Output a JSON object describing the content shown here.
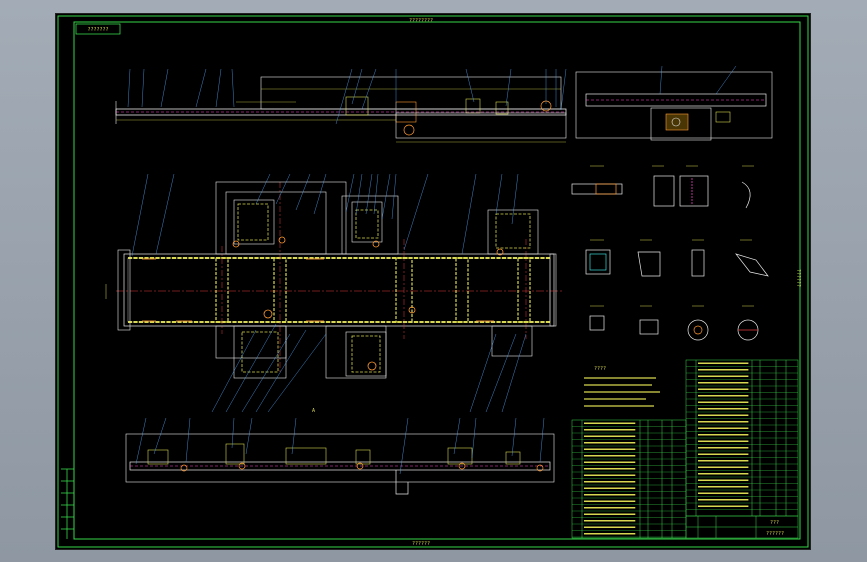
{
  "drawing": {
    "top_title": "????????",
    "corner_label": "???????",
    "side_label": "??????",
    "bottom_label": "??????",
    "view_label": "A"
  },
  "tables": {
    "notes_title": "????",
    "title_block_name": "???",
    "title_block_code": "??????"
  },
  "colors": {
    "sheet_bg": "#000000",
    "frame": "#39d64a",
    "outline": "#e8e8e8",
    "dimension": "#d8d850",
    "center_line": "#e03a3a",
    "leader": "#4fa8ff",
    "hidden": "#ff4ad0",
    "highlight": "#ff9933",
    "cyan": "#3fd6d6"
  }
}
